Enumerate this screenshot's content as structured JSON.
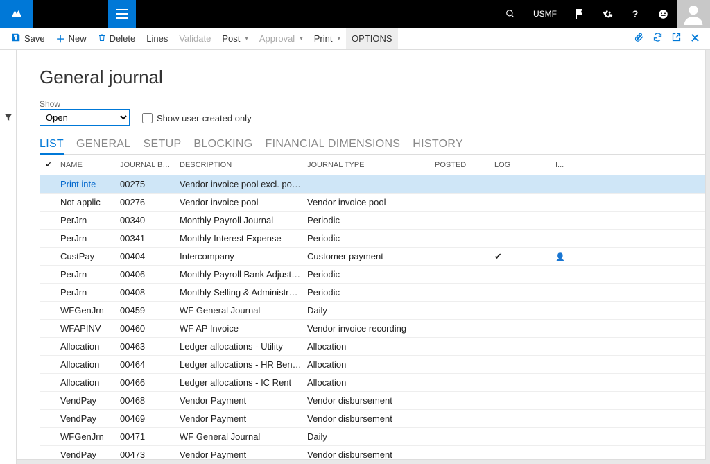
{
  "topbar": {
    "company": "USMF"
  },
  "actionbar": {
    "save": "Save",
    "new": "New",
    "delete": "Delete",
    "lines": "Lines",
    "validate": "Validate",
    "post": "Post",
    "approval": "Approval",
    "print": "Print",
    "options": "OPTIONS"
  },
  "page": {
    "title": "General journal",
    "show_label": "Show",
    "show_value": "Open",
    "user_created_label": "Show user-created only"
  },
  "tabs": {
    "list": "LIST",
    "general": "GENERAL",
    "setup": "SETUP",
    "blocking": "BLOCKING",
    "findim": "FINANCIAL DIMENSIONS",
    "history": "HISTORY"
  },
  "grid": {
    "headers": {
      "name": "NAME",
      "batch": "JOURNAL BAT...",
      "desc": "DESCRIPTION",
      "type": "JOURNAL TYPE",
      "posted": "POSTED",
      "log": "LOG",
      "inuse": "I..."
    },
    "rows": [
      {
        "name": "Print inte",
        "batch": "00275",
        "desc": "Vendor invoice pool excl. posting",
        "type": "",
        "log": "",
        "inuse": "",
        "selected": true
      },
      {
        "name": "Not applic",
        "batch": "00276",
        "desc": "Vendor invoice pool",
        "type": "Vendor invoice pool",
        "log": "",
        "inuse": ""
      },
      {
        "name": "PerJrn",
        "batch": "00340",
        "desc": "Monthly Payroll Journal",
        "type": "Periodic",
        "log": "",
        "inuse": ""
      },
      {
        "name": "PerJrn",
        "batch": "00341",
        "desc": "Monthly Interest Expense",
        "type": "Periodic",
        "log": "",
        "inuse": ""
      },
      {
        "name": "CustPay",
        "batch": "00404",
        "desc": "Intercompany",
        "type": "Customer payment",
        "log": "✔",
        "inuse": "y"
      },
      {
        "name": "PerJrn",
        "batch": "00406",
        "desc": "Monthly Payroll Bank Adjustment",
        "type": "Periodic",
        "log": "",
        "inuse": ""
      },
      {
        "name": "PerJrn",
        "batch": "00408",
        "desc": "Monthly Selling & Administrative I",
        "type": "Periodic",
        "log": "",
        "inuse": ""
      },
      {
        "name": "WFGenJrn",
        "batch": "00459",
        "desc": "WF General Journal",
        "type": "Daily",
        "log": "",
        "inuse": ""
      },
      {
        "name": "WFAPINV",
        "batch": "00460",
        "desc": "WF AP Invoice",
        "type": "Vendor invoice recording",
        "log": "",
        "inuse": ""
      },
      {
        "name": "Allocation",
        "batch": "00463",
        "desc": "Ledger allocations - Utility",
        "type": "Allocation",
        "log": "",
        "inuse": ""
      },
      {
        "name": "Allocation",
        "batch": "00464",
        "desc": "Ledger allocations - HR Benefits",
        "type": "Allocation",
        "log": "",
        "inuse": ""
      },
      {
        "name": "Allocation",
        "batch": "00466",
        "desc": "Ledger allocations - IC Rent",
        "type": "Allocation",
        "log": "",
        "inuse": ""
      },
      {
        "name": "VendPay",
        "batch": "00468",
        "desc": "Vendor Payment",
        "type": "Vendor disbursement",
        "log": "",
        "inuse": ""
      },
      {
        "name": "VendPay",
        "batch": "00469",
        "desc": "Vendor Payment",
        "type": "Vendor disbursement",
        "log": "",
        "inuse": ""
      },
      {
        "name": "WFGenJrn",
        "batch": "00471",
        "desc": "WF General Journal",
        "type": "Daily",
        "log": "",
        "inuse": ""
      },
      {
        "name": "VendPay",
        "batch": "00473",
        "desc": "Vendor Payment",
        "type": "Vendor disbursement",
        "log": "",
        "inuse": ""
      }
    ]
  }
}
